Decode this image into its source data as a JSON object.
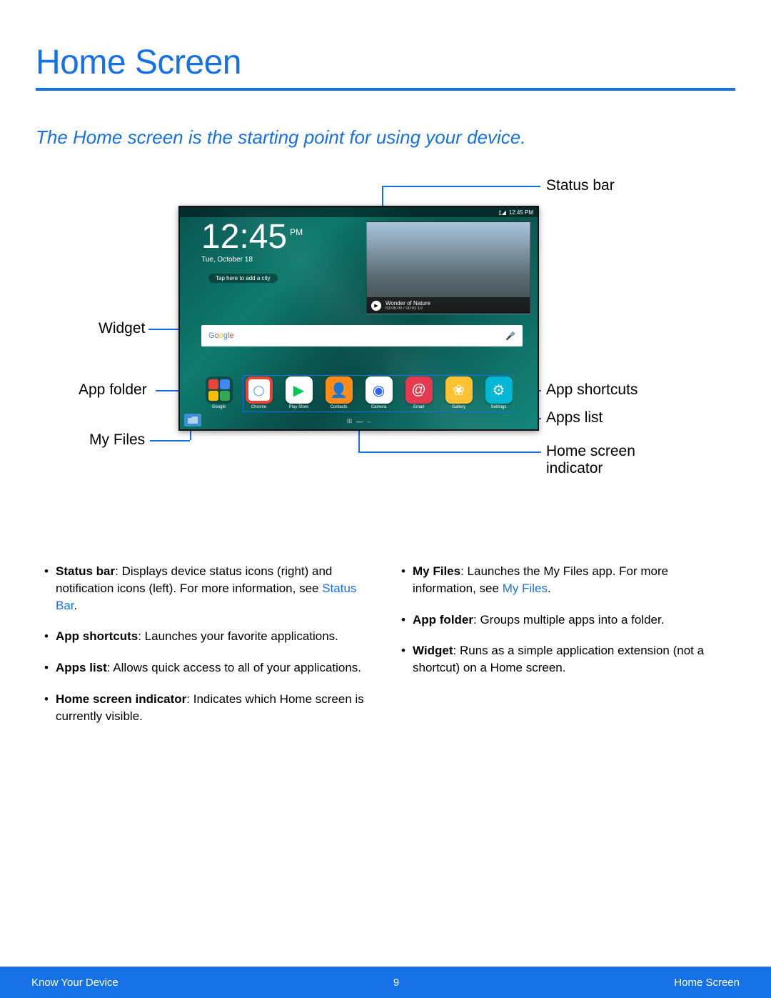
{
  "title": "Home Screen",
  "subtitle": "The Home screen is the starting point for using your device.",
  "tablet": {
    "status_time": "12:45 PM",
    "clock": {
      "time": "12:45",
      "ampm": "PM",
      "date": "Tue, October 18",
      "tap_hint": "Tap here to add a city"
    },
    "video": {
      "title": "Wonder of Nature",
      "time": "03:05:00 / 00:01:10"
    },
    "search": {
      "brand": "Google"
    },
    "apps": [
      {
        "label": "Google",
        "type": "folder"
      },
      {
        "label": "Chrome",
        "color": "#fff",
        "fg": "#4285F4"
      },
      {
        "label": "Play Store",
        "color": "#fff"
      },
      {
        "label": "Contacts",
        "color": "#ff8c1a"
      },
      {
        "label": "Camera",
        "color": "#fff"
      },
      {
        "label": "Email",
        "color": "#e63950"
      },
      {
        "label": "Gallery",
        "color": "#ffc233"
      },
      {
        "label": "Settings",
        "color": "#00b8d4"
      }
    ]
  },
  "callouts": {
    "status_bar": "Status bar",
    "widget": "Widget",
    "app_folder": "App folder",
    "my_files": "My Files",
    "app_shortcuts": "App shortcuts",
    "apps_list": "Apps list",
    "home_indicator": "Home screen indicator"
  },
  "bullets_left": [
    {
      "b": "Status bar",
      "t": ": Displays device status icons (right) and notification icons (left). For more information, see ",
      "link": "Status Bar",
      "after": "."
    },
    {
      "b": "App shortcuts",
      "t": ": Launches your favorite applications."
    },
    {
      "b": "Apps list",
      "t": ": Allows quick access to all of your applications."
    },
    {
      "b": "Home screen indicator",
      "t": ": Indicates which Home screen is currently visible."
    }
  ],
  "bullets_right": [
    {
      "b": "My Files",
      "t": ": Launches the My Files app. For more information, see ",
      "link": "My Files",
      "after": "."
    },
    {
      "b": "App folder",
      "t": ": Groups multiple apps into a folder."
    },
    {
      "b": "Widget",
      "t": ": Runs as a simple application extension (not a shortcut) on a Home screen."
    }
  ],
  "footer": {
    "left": "Know Your Device",
    "center": "9",
    "right": "Home Screen"
  }
}
